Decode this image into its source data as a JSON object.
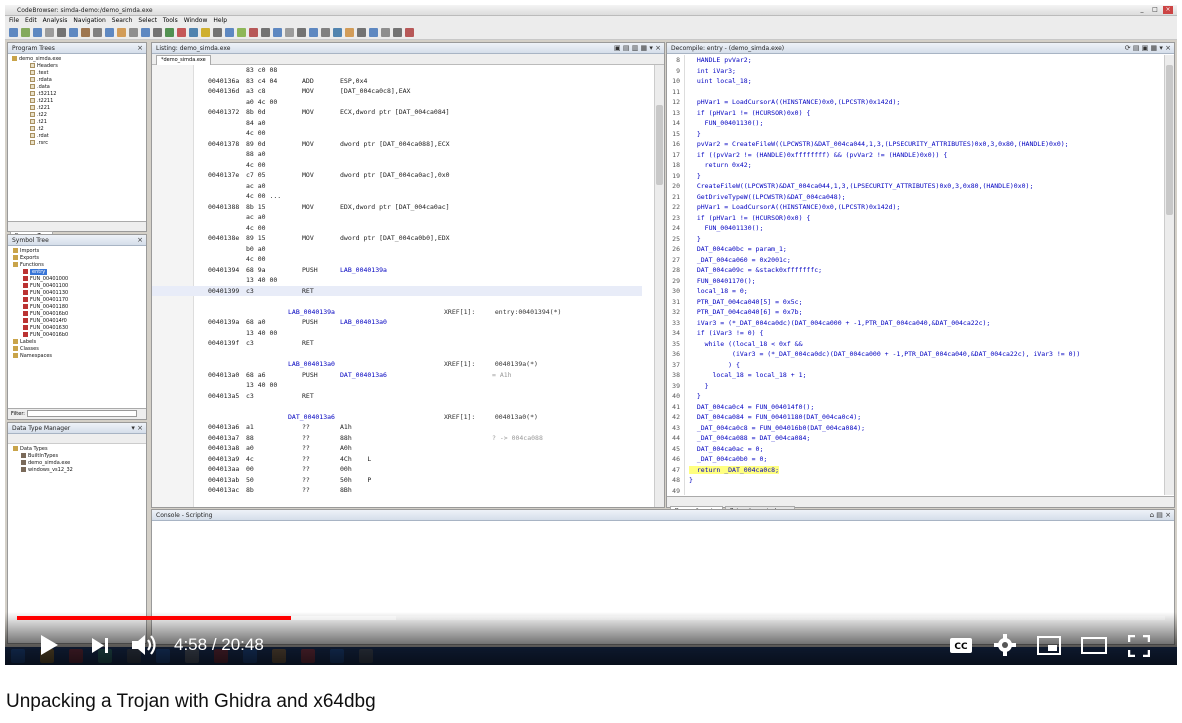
{
  "window": {
    "title": "CodeBrowser: simda-demo:/demo_simda.exe"
  },
  "menu": [
    "File",
    "Edit",
    "Analysis",
    "Navigation",
    "Search",
    "Select",
    "Tools",
    "Window",
    "Help"
  ],
  "program_trees": {
    "header": "Program Trees",
    "root": "demo_simda.exe",
    "items": [
      "Headers",
      ".text",
      ".rdata",
      ".data",
      ".t32112",
      ".t2211",
      ".t221",
      ".t22",
      ".t21",
      ".t2",
      ".rdat",
      ".rsrc"
    ],
    "tab": "Program Tree"
  },
  "symbol_tree": {
    "header": "Symbol Tree",
    "items": [
      "Imports",
      "Exports",
      "Functions"
    ],
    "functions": [
      "entry",
      "FUN_00401000",
      "FUN_00401100",
      "FUN_00401130",
      "FUN_00401170",
      "FUN_00401180",
      "FUN_004016b0",
      "FUN_004014f0",
      "FUN_00401630",
      "FUN_004016b0"
    ],
    "others": [
      "Labels",
      "Classes",
      "Namespaces"
    ],
    "filter_label": "Filter:"
  },
  "data_type_manager": {
    "header": "Data Type Manager",
    "items": [
      "Data Types",
      "BuiltInTypes",
      "demo_simda.exe",
      "windows_vs12_32"
    ],
    "filter_label": "Filter:"
  },
  "listing": {
    "header": "Listing: demo_simda.exe",
    "tab": "*demo_simda.exe",
    "lines": [
      {
        "addr": "",
        "bytes": "83 c0 08",
        "mnem": "",
        "ops": "",
        "extra": ""
      },
      {
        "addr": "0040136a",
        "bytes": "83 c4 04",
        "mnem": "ADD",
        "ops": "ESP,0x4",
        "extra": ""
      },
      {
        "addr": "0040136d",
        "bytes": "a3 c8",
        "mnem": "MOV",
        "ops": "[DAT_004ca0c8],EAX",
        "extra": ""
      },
      {
        "addr": "",
        "bytes": "a0 4c 00",
        "mnem": "",
        "ops": "",
        "extra": ""
      },
      {
        "addr": "00401372",
        "bytes": "8b 0d",
        "mnem": "MOV",
        "ops": "ECX,dword ptr [DAT_004ca084]",
        "extra": ""
      },
      {
        "addr": "",
        "bytes": "84 a0",
        "mnem": "",
        "ops": "",
        "extra": ""
      },
      {
        "addr": "",
        "bytes": "4c 00",
        "mnem": "",
        "ops": "",
        "extra": ""
      },
      {
        "addr": "00401378",
        "bytes": "89 0d",
        "mnem": "MOV",
        "ops": "dword ptr [DAT_004ca088],ECX",
        "extra": ""
      },
      {
        "addr": "",
        "bytes": "88 a0",
        "mnem": "",
        "ops": "",
        "extra": ""
      },
      {
        "addr": "",
        "bytes": "4c 00",
        "mnem": "",
        "ops": "",
        "extra": ""
      },
      {
        "addr": "0040137e",
        "bytes": "c7 05",
        "mnem": "MOV",
        "ops": "dword ptr [DAT_004ca0ac],0x0",
        "extra": ""
      },
      {
        "addr": "",
        "bytes": "ac a0",
        "mnem": "",
        "ops": "",
        "extra": ""
      },
      {
        "addr": "",
        "bytes": "4c 00 ...",
        "mnem": "",
        "ops": "",
        "extra": ""
      },
      {
        "addr": "00401388",
        "bytes": "8b 15",
        "mnem": "MOV",
        "ops": "EDX,dword ptr [DAT_004ca0ac]",
        "extra": ""
      },
      {
        "addr": "",
        "bytes": "ac a0",
        "mnem": "",
        "ops": "",
        "extra": ""
      },
      {
        "addr": "",
        "bytes": "4c 00",
        "mnem": "",
        "ops": "",
        "extra": ""
      },
      {
        "addr": "0040138e",
        "bytes": "89 15",
        "mnem": "MOV",
        "ops": "dword ptr [DAT_004ca0b0],EDX",
        "extra": ""
      },
      {
        "addr": "",
        "bytes": "b0 a0",
        "mnem": "",
        "ops": "",
        "extra": ""
      },
      {
        "addr": "",
        "bytes": "4c 00",
        "mnem": "",
        "ops": "",
        "extra": ""
      },
      {
        "addr": "00401394",
        "bytes": "68 9a",
        "mnem": "PUSH",
        "ops": "LAB_0040139a",
        "extra": ""
      },
      {
        "addr": "",
        "bytes": "13 40 00",
        "mnem": "",
        "ops": "",
        "extra": ""
      },
      {
        "addr": "00401399",
        "bytes": "c3",
        "mnem": "RET",
        "ops": "",
        "extra": ""
      },
      {
        "addr": "",
        "bytes": "",
        "mnem": "",
        "ops": "",
        "extra": ""
      },
      {
        "addr": "",
        "bytes": "",
        "mnem": "LAB_0040139a",
        "ops": "",
        "extra": "XREF[1]:     entry:00401394(*)"
      },
      {
        "addr": "0040139a",
        "bytes": "68 a0",
        "mnem": "PUSH",
        "ops": "LAB_004013a0",
        "extra": ""
      },
      {
        "addr": "",
        "bytes": "13 40 00",
        "mnem": "",
        "ops": "",
        "extra": ""
      },
      {
        "addr": "0040139f",
        "bytes": "c3",
        "mnem": "RET",
        "ops": "",
        "extra": ""
      },
      {
        "addr": "",
        "bytes": "",
        "mnem": "",
        "ops": "",
        "extra": ""
      },
      {
        "addr": "",
        "bytes": "",
        "mnem": "LAB_004013a0",
        "ops": "",
        "extra": "XREF[1]:     0040139a(*)"
      },
      {
        "addr": "004013a0",
        "bytes": "68 a6",
        "mnem": "PUSH",
        "ops": "DAT_004013a6",
        "extra": "= A1h"
      },
      {
        "addr": "",
        "bytes": "13 40 00",
        "mnem": "",
        "ops": "",
        "extra": ""
      },
      {
        "addr": "004013a5",
        "bytes": "c3",
        "mnem": "RET",
        "ops": "",
        "extra": ""
      },
      {
        "addr": "",
        "bytes": "",
        "mnem": "",
        "ops": "",
        "extra": ""
      },
      {
        "addr": "",
        "bytes": "",
        "mnem": "DAT_004013a6",
        "ops": "",
        "extra": "XREF[1]:     004013a0(*)"
      },
      {
        "addr": "004013a6",
        "bytes": "a1",
        "mnem": "??",
        "ops": "A1h",
        "extra": ""
      },
      {
        "addr": "004013a7",
        "bytes": "88",
        "mnem": "??",
        "ops": "88h",
        "extra": "? -> 004ca088"
      },
      {
        "addr": "004013a8",
        "bytes": "a0",
        "mnem": "??",
        "ops": "A0h",
        "extra": ""
      },
      {
        "addr": "004013a9",
        "bytes": "4c",
        "mnem": "??",
        "ops": "4Ch    L",
        "extra": ""
      },
      {
        "addr": "004013aa",
        "bytes": "00",
        "mnem": "??",
        "ops": "00h",
        "extra": ""
      },
      {
        "addr": "004013ab",
        "bytes": "50",
        "mnem": "??",
        "ops": "50h    P",
        "extra": ""
      },
      {
        "addr": "004013ac",
        "bytes": "8b",
        "mnem": "??",
        "ops": "8Bh",
        "extra": ""
      }
    ]
  },
  "decompile": {
    "header": "Decompile: entry - (demo_simda.exe)",
    "lines": [
      {
        "n": "8",
        "t": "  HANDLE pvVar2;"
      },
      {
        "n": "9",
        "t": "  int iVar3;"
      },
      {
        "n": "10",
        "t": "  uint local_18;"
      },
      {
        "n": "11",
        "t": ""
      },
      {
        "n": "12",
        "t": "  pHVar1 = LoadCursorA((HINSTANCE)0x0,(LPCSTR)0x142d);"
      },
      {
        "n": "13",
        "t": "  if (pHVar1 != (HCURSOR)0x0) {"
      },
      {
        "n": "14",
        "t": "    FUN_00401130();"
      },
      {
        "n": "15",
        "t": "  }"
      },
      {
        "n": "16",
        "t": "  pvVar2 = CreateFileW((LPCWSTR)&DAT_004ca044,1,3,(LPSECURITY_ATTRIBUTES)0x0,3,0x80,(HANDLE)0x0);"
      },
      {
        "n": "17",
        "t": "  if ((pvVar2 != (HANDLE)0xffffffff) && (pvVar2 != (HANDLE)0x0)) {"
      },
      {
        "n": "18",
        "t": "    return 0x42;"
      },
      {
        "n": "19",
        "t": "  }"
      },
      {
        "n": "20",
        "t": "  CreateFileW((LPCWSTR)&DAT_004ca044,1,3,(LPSECURITY_ATTRIBUTES)0x0,3,0x80,(HANDLE)0x0);"
      },
      {
        "n": "21",
        "t": "  GetDriveTypeW((LPCWSTR)&DAT_004ca048);"
      },
      {
        "n": "22",
        "t": "  pHVar1 = LoadCursorA((HINSTANCE)0x0,(LPCSTR)0x142d);"
      },
      {
        "n": "23",
        "t": "  if (pHVar1 != (HCURSOR)0x0) {"
      },
      {
        "n": "24",
        "t": "    FUN_00401130();"
      },
      {
        "n": "25",
        "t": "  }"
      },
      {
        "n": "26",
        "t": "  DAT_004ca0bc = param_1;"
      },
      {
        "n": "27",
        "t": "  _DAT_004ca060 = 0x2001c;"
      },
      {
        "n": "28",
        "t": "  DAT_004ca09c = &stack0xfffffffc;"
      },
      {
        "n": "29",
        "t": "  FUN_00401170();"
      },
      {
        "n": "30",
        "t": "  local_18 = 0;"
      },
      {
        "n": "31",
        "t": "  PTR_DAT_004ca040[5] = 0x5c;"
      },
      {
        "n": "32",
        "t": "  PTR_DAT_004ca040[6] = 0x7b;"
      },
      {
        "n": "33",
        "t": "  iVar3 = (*_DAT_004ca0dc)(DAT_004ca000 + -1,PTR_DAT_004ca040,&DAT_004ca22c);"
      },
      {
        "n": "34",
        "t": "  if (iVar3 != 0) {"
      },
      {
        "n": "35",
        "t": "    while ((local_18 < 0xf &&"
      },
      {
        "n": "36",
        "t": "           (iVar3 = (*_DAT_004ca0dc)(DAT_004ca000 + -1,PTR_DAT_004ca040,&DAT_004ca22c), iVar3 != 0))"
      },
      {
        "n": "37",
        "t": "          ) {"
      },
      {
        "n": "38",
        "t": "      local_18 = local_18 + 1;"
      },
      {
        "n": "39",
        "t": "    }"
      },
      {
        "n": "40",
        "t": "  }"
      },
      {
        "n": "41",
        "t": "  DAT_004ca0c4 = FUN_004014f0();"
      },
      {
        "n": "42",
        "t": "  DAT_004ca084 = FUN_00401180(DAT_004ca0c4);"
      },
      {
        "n": "43",
        "t": "  _DAT_004ca0c8 = FUN_004016b0(DAT_004ca084);"
      },
      {
        "n": "44",
        "t": "  _DAT_004ca088 = DAT_004ca084;"
      },
      {
        "n": "45",
        "t": "  DAT_004ca0ac = 0;"
      },
      {
        "n": "46",
        "t": "  _DAT_004ca0b0 = 0;"
      },
      {
        "n": "47",
        "t": "  return _DAT_004ca0c8;"
      },
      {
        "n": "48",
        "t": "}"
      },
      {
        "n": "49",
        "t": ""
      }
    ],
    "tabs": [
      "Decompile: entry",
      "Bytes: demo_simda.exe"
    ]
  },
  "console": {
    "header": "Console - Scripting"
  },
  "player": {
    "time_current": "4:58",
    "time_total": "20:48",
    "time_sep": " / ",
    "progress": 0.239,
    "buffered": 0.33
  },
  "video_title": "Unpacking a Trojan with Ghidra and x64dbg",
  "colors": {
    "progress": "#ff0000",
    "decomp_text": "#0000c0",
    "highlight": "#ffff80"
  }
}
